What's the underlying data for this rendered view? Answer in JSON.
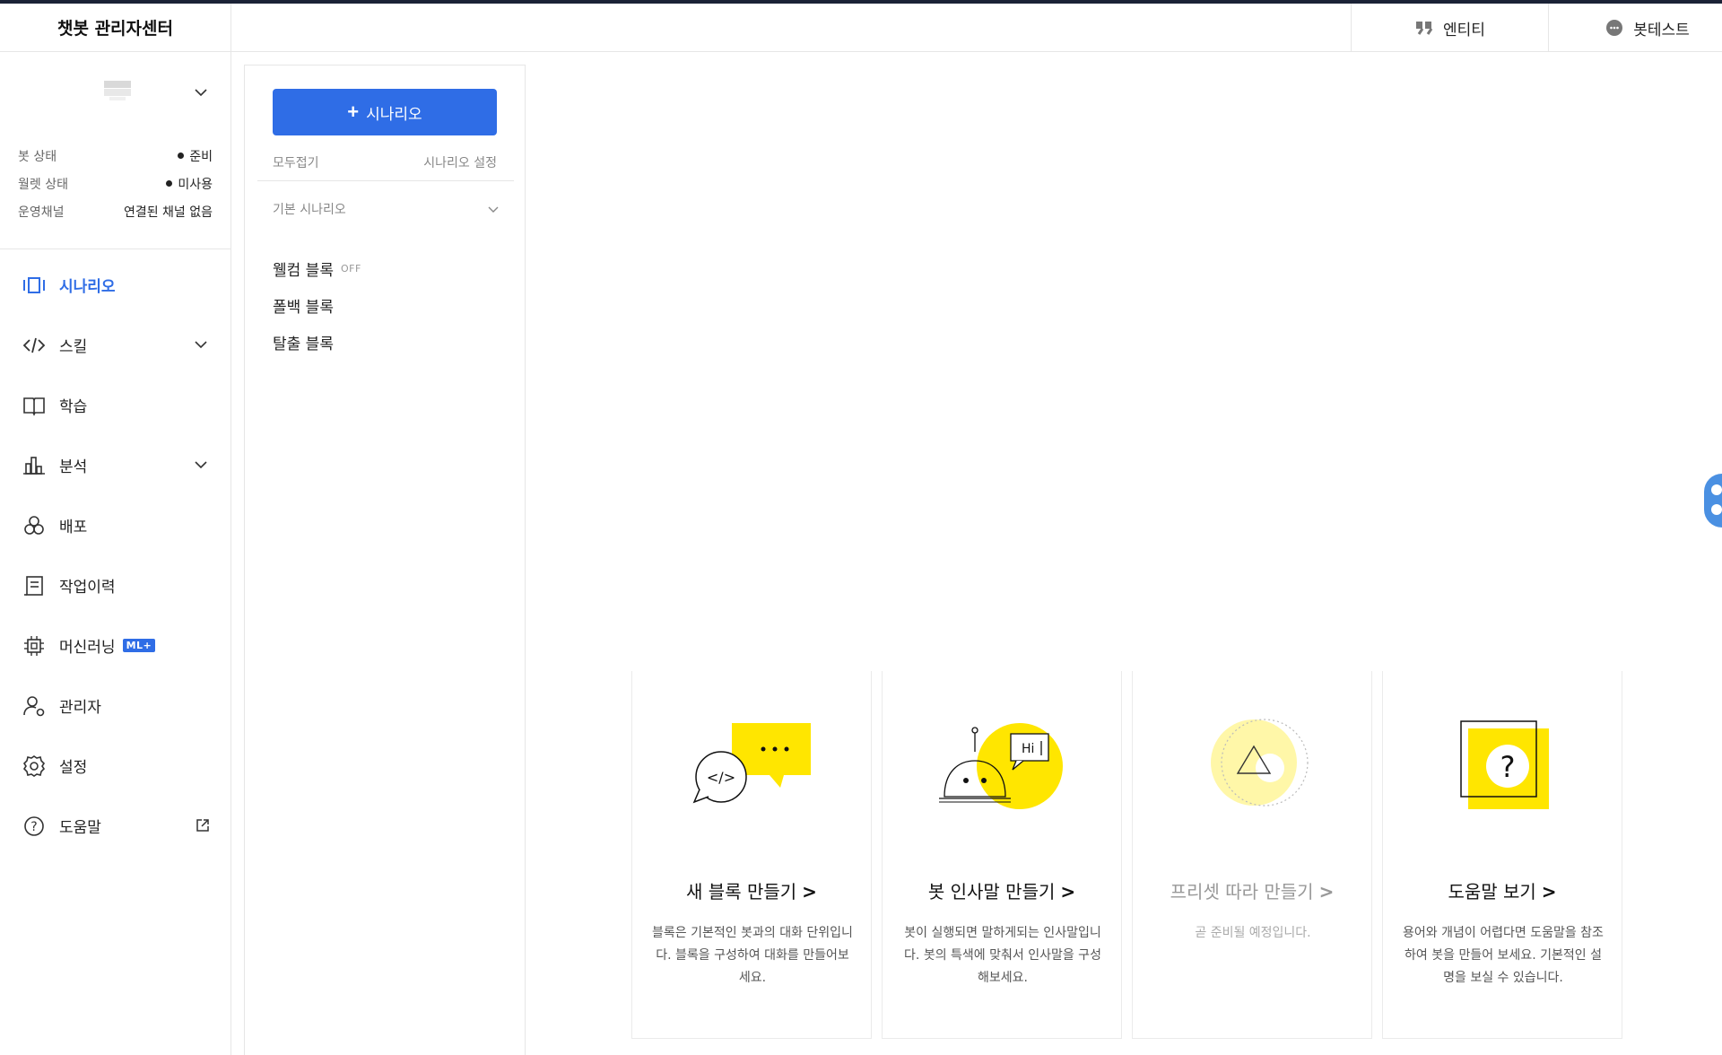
{
  "brand": {
    "title": "챗봇 관리자센터"
  },
  "bot_status": {
    "rows": [
      {
        "key": "봇 상태",
        "value": "준비"
      },
      {
        "key": "월렛 상태",
        "value": "미사용"
      },
      {
        "key": "운영채널",
        "value": "연결된 채널 없음"
      }
    ]
  },
  "nav": {
    "scenario": "시나리오",
    "skill": "스킬",
    "learning": "학습",
    "analytics": "분석",
    "deploy": "배포",
    "history": "작업이력",
    "ml": "머신러닝",
    "ml_badge": "ML+",
    "admin": "관리자",
    "settings": "설정",
    "help": "도움말"
  },
  "header": {
    "entity": "엔티티",
    "bottest": "봇테스트"
  },
  "scenario_panel": {
    "add_button": "시나리오",
    "collapse_all": "모두접기",
    "scenario_settings": "시나리오 설정",
    "group_title": "기본 시나리오",
    "blocks": [
      {
        "label": "웰컴 블록",
        "badge": "OFF"
      },
      {
        "label": "폴백 블록",
        "badge": ""
      },
      {
        "label": "탈출 블록",
        "badge": ""
      }
    ]
  },
  "cards": [
    {
      "title": "새 블록 만들기",
      "desc": "블록은 기본적인 봇과의 대화 단위입니다. 블록을 구성하여 대화를 만들어보세요."
    },
    {
      "title": "봇 인사말 만들기",
      "desc": "봇이 실행되면 말하게되는 인사말입니다. 봇의 특색에 맞춰서 인사말을 구성해보세요.",
      "illo_text": "Hi"
    },
    {
      "title": "프리셋 따라 만들기",
      "desc": "곧 준비될 예정입니다."
    },
    {
      "title": "도움말 보기",
      "desc": "용어와 개념이 어렵다면 도움말을 참조하여 봇을 만들어 보세요. 기본적인 설명을 보실 수 있습니다.",
      "illo_text": "?"
    }
  ],
  "colors": {
    "accent": "#2f6de6",
    "highlight": "#ffe600",
    "topbar": "#1b2236"
  }
}
